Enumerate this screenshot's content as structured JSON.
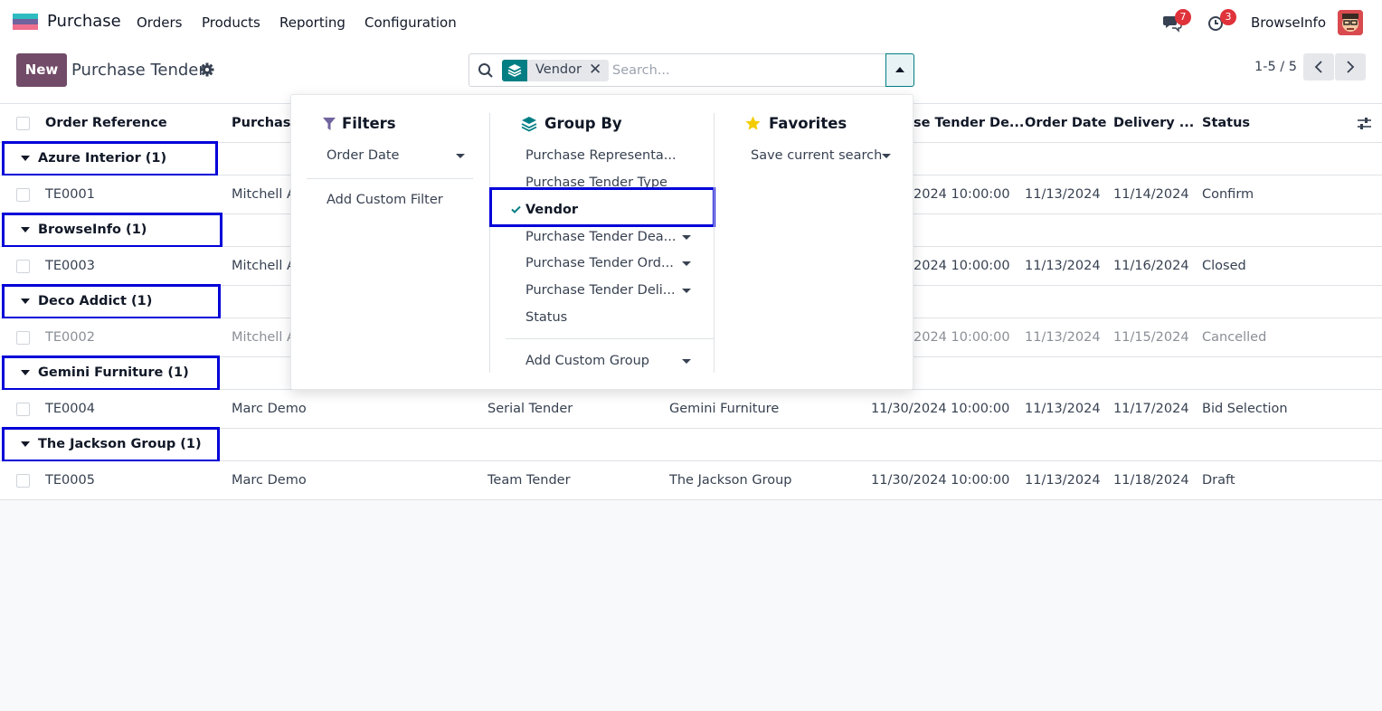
{
  "navbar": {
    "app_name": "Purchase",
    "menus": [
      "Orders",
      "Products",
      "Reporting",
      "Configuration"
    ],
    "messages_badge": "7",
    "activities_badge": "3",
    "user_name": "BrowseInfo"
  },
  "control_panel": {
    "new_label": "New",
    "breadcrumb": "Purchase Tender",
    "facet_label": "Vendor",
    "search_placeholder": "Search...",
    "pager": "1-5 / 5"
  },
  "list": {
    "columns": [
      "Order Reference",
      "Purchase",
      "se Tender De...",
      "Order Date",
      "Delivery ...",
      "Status"
    ],
    "groups": [
      {
        "label": "Azure Interior (1)",
        "row": {
          "ref": "TE0001",
          "rep": "Mitchell A",
          "type": "",
          "vendor": "",
          "deadline": "2024 10:00:00",
          "order_date": "11/13/2024",
          "delivery": "11/14/2024",
          "status": "Confirm"
        }
      },
      {
        "label": "BrowseInfo (1)",
        "row": {
          "ref": "TE0003",
          "rep": "Mitchell A",
          "type": "",
          "vendor": "",
          "deadline": "2024 10:00:00",
          "order_date": "11/13/2024",
          "delivery": "11/16/2024",
          "status": "Closed"
        }
      },
      {
        "label": "Deco Addict (1)",
        "row": {
          "ref": "TE0002",
          "rep": "Mitchell A",
          "type": "",
          "vendor": "",
          "deadline": "2024 10:00:00",
          "order_date": "11/13/2024",
          "delivery": "11/15/2024",
          "status": "Cancelled"
        }
      },
      {
        "label": "Gemini Furniture (1)",
        "row": {
          "ref": "TE0004",
          "rep": "Marc Demo",
          "type": "Serial Tender",
          "vendor": "Gemini Furniture",
          "deadline": "11/30/2024 10:00:00",
          "order_date": "11/13/2024",
          "delivery": "11/17/2024",
          "status": "Bid Selection"
        }
      },
      {
        "label": "The Jackson Group (1)",
        "row": {
          "ref": "TE0005",
          "rep": "Marc Demo",
          "type": "Team Tender",
          "vendor": "The Jackson Group",
          "deadline": "11/30/2024 10:00:00",
          "order_date": "11/13/2024",
          "delivery": "11/18/2024",
          "status": "Draft"
        }
      }
    ]
  },
  "dropdown": {
    "filters": {
      "title": "Filters",
      "order_date": "Order Date",
      "add_custom": "Add Custom Filter"
    },
    "group_by": {
      "title": "Group By",
      "items": [
        "Purchase Representa...",
        "Purchase Tender Type",
        "Vendor",
        "Purchase Tender Dea...",
        "Purchase Tender Ord...",
        "Purchase Tender Deli...",
        "Status"
      ],
      "add_custom": "Add Custom Group"
    },
    "favorites": {
      "title": "Favorites",
      "save": "Save current search"
    }
  },
  "colors": {
    "primary": "#714b67",
    "accent": "#017e84",
    "highlight": "#0000d8",
    "badge": "#e0323a"
  }
}
